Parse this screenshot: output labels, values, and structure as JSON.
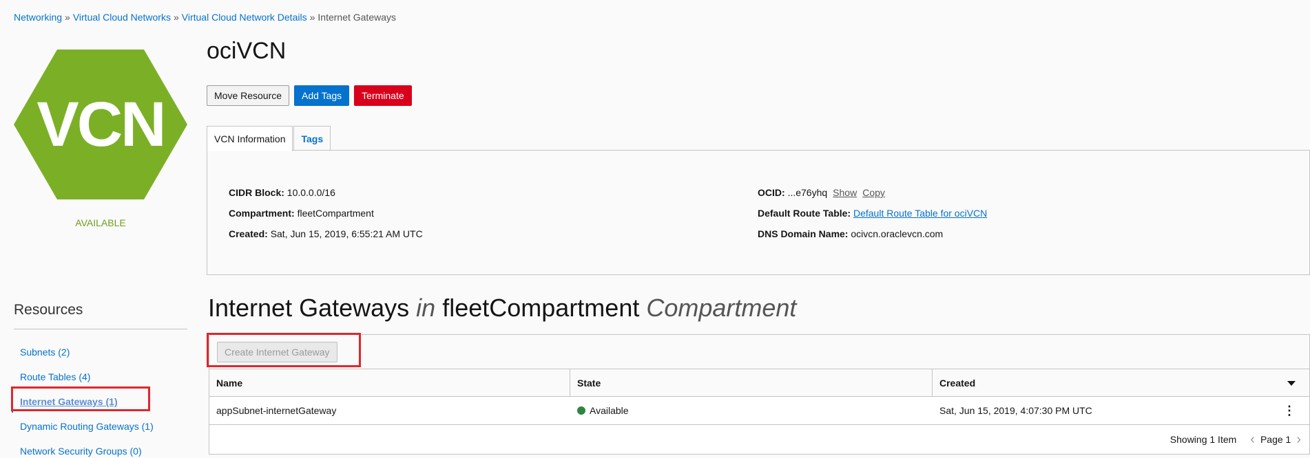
{
  "breadcrumb": {
    "items": [
      "Networking",
      "Virtual Cloud Networks",
      "Virtual Cloud Network Details"
    ],
    "separator": "»",
    "current": "Internet Gateways"
  },
  "resource_icon": {
    "label": "VCN",
    "color": "#7bb026",
    "status": "AVAILABLE"
  },
  "title": "ociVCN",
  "actions": {
    "move": "Move Resource",
    "add_tags": "Add Tags",
    "terminate": "Terminate"
  },
  "tabs": [
    {
      "label": "VCN Information"
    },
    {
      "label": "Tags"
    }
  ],
  "info": {
    "cidr_label": "CIDR Block:",
    "cidr_value": "10.0.0.0/16",
    "compartment_label": "Compartment:",
    "compartment_value": "fleetCompartment",
    "created_label": "Created:",
    "created_value": "Sat, Jun 15, 2019, 6:55:21 AM UTC",
    "ocid_label": "OCID:",
    "ocid_value": "...e76yhq",
    "ocid_show": "Show",
    "ocid_copy": "Copy",
    "route_label": "Default Route Table:",
    "route_value": "Default Route Table for ociVCN",
    "dns_label": "DNS Domain Name:",
    "dns_value": "ocivcn.oraclevcn.com"
  },
  "resources": {
    "title": "Resources",
    "items": [
      {
        "label": "Subnets (2)"
      },
      {
        "label": "Route Tables (4)"
      },
      {
        "label": "Internet Gateways (1)"
      },
      {
        "label": "Dynamic Routing Gateways (1)"
      },
      {
        "label": "Network Security Groups (0)"
      }
    ]
  },
  "section": {
    "part1": "Internet Gateways",
    "in": "in",
    "compartment": "fleetCompartment",
    "suffix": "Compartment"
  },
  "table": {
    "create_button": "Create Internet Gateway",
    "columns": [
      "Name",
      "State",
      "Created"
    ],
    "rows": [
      {
        "name": "appSubnet-internetGateway",
        "state": "Available",
        "created": "Sat, Jun 15, 2019, 4:07:30 PM UTC"
      }
    ],
    "footer_count": "Showing 1 Item",
    "page_label": "Page 1"
  },
  "colors": {
    "accent": "#0572ce",
    "danger": "#d9001b",
    "available": "#2e8540",
    "highlight": "#e0262b"
  }
}
